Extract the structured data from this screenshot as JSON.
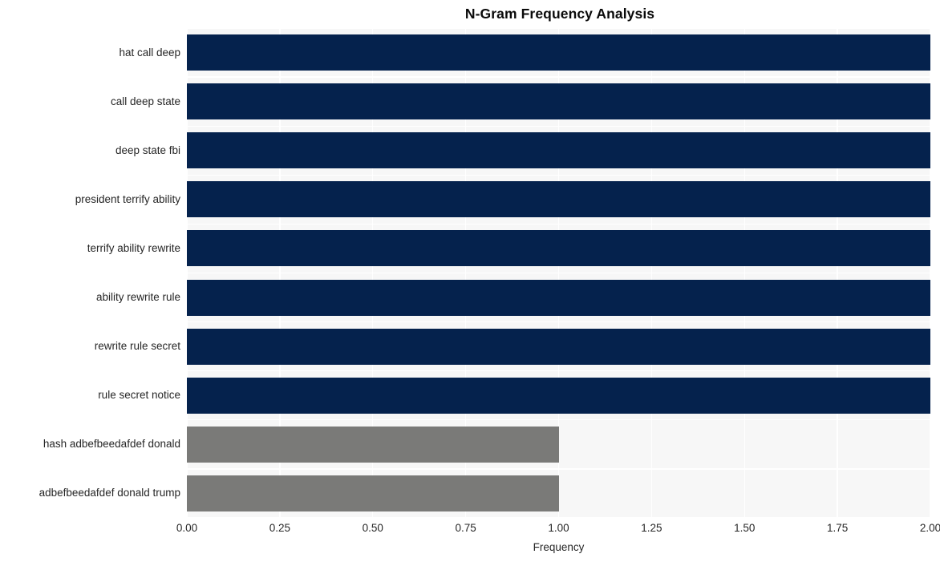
{
  "chart_data": {
    "type": "bar",
    "orientation": "horizontal",
    "title": "N-Gram Frequency Analysis",
    "xlabel": "Frequency",
    "ylabel": "",
    "categories": [
      "hat call deep",
      "call deep state",
      "deep state fbi",
      "president terrify ability",
      "terrify ability rewrite",
      "ability rewrite rule",
      "rewrite rule secret",
      "rule secret notice",
      "hash adbefbeedafdef donald",
      "adbefbeedafdef donald trump"
    ],
    "values": [
      2,
      2,
      2,
      2,
      2,
      2,
      2,
      2,
      1,
      1
    ],
    "bar_colors": [
      "#05224d",
      "#05224d",
      "#05224d",
      "#05224d",
      "#05224d",
      "#05224d",
      "#05224d",
      "#05224d",
      "#7a7a78",
      "#7a7a78"
    ],
    "xlim": [
      0.0,
      2.0
    ],
    "xticks": [
      0.0,
      0.25,
      0.5,
      0.75,
      1.0,
      1.25,
      1.5,
      1.75,
      2.0
    ],
    "xtick_labels": [
      "0.00",
      "0.25",
      "0.50",
      "0.75",
      "1.00",
      "1.25",
      "1.50",
      "1.75",
      "2.00"
    ],
    "grid": true,
    "grid_color": "#ffffff",
    "legend": null,
    "plot_background": "#f7f7f7",
    "figure_background": "#ffffff",
    "title_color": "#0a0a0a",
    "tick_label_color": "#262626"
  }
}
